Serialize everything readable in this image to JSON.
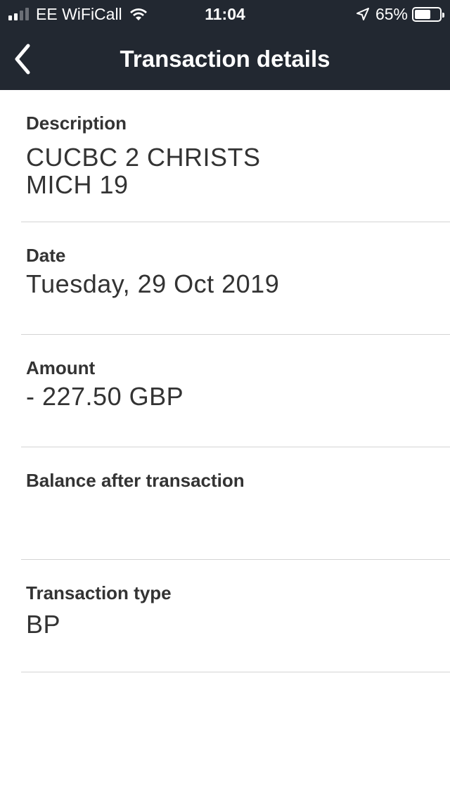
{
  "status_bar": {
    "carrier": "EE WiFiCall",
    "time": "11:04",
    "battery_percent": "65%",
    "battery_level": 0.65,
    "signal_bars_active": 2,
    "signal_bars_total": 4
  },
  "header": {
    "title": "Transaction details",
    "background_color": "#222831"
  },
  "details": {
    "description": {
      "label": "Description",
      "value_line1": "CUCBC 2 CHRISTS",
      "value_line2": "MICH 19"
    },
    "date": {
      "label": "Date",
      "value": "Tuesday, 29 Oct 2019"
    },
    "amount": {
      "label": "Amount",
      "value": "- 227.50 GBP"
    },
    "balance": {
      "label": "Balance after transaction",
      "value": ""
    },
    "type": {
      "label": "Transaction type",
      "value": "BP"
    }
  },
  "icons": {
    "back": "chevron-left-icon",
    "wifi": "wifi-icon",
    "location": "location-arrow-icon",
    "battery": "battery-icon",
    "signal": "signal-bars-icon"
  }
}
